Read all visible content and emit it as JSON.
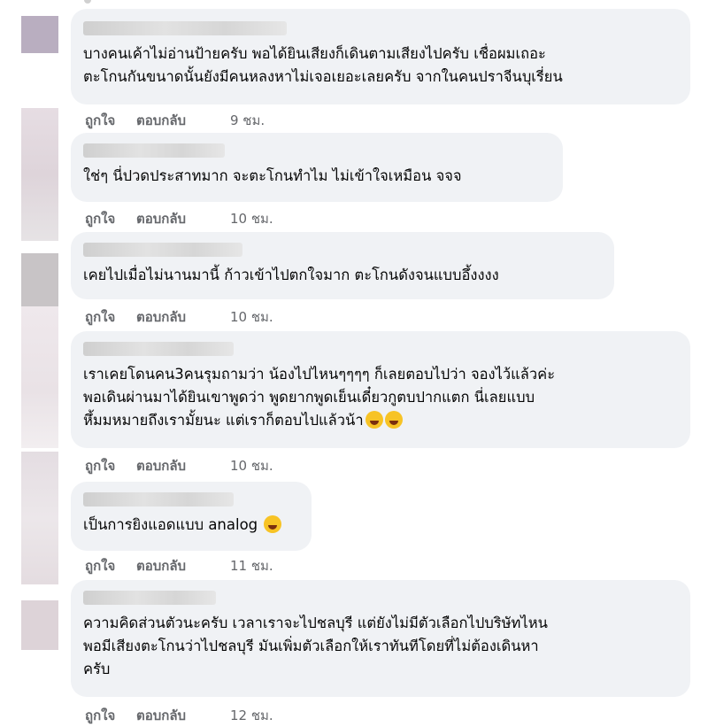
{
  "comments": [
    {
      "text": "บางคนเค้าไม่อ่านป้ายครับ พอได้ยินเสียงก็เดินตามเสียงไปครับ เชื่อผมเถอะ\nตะโกนกันขนาดนั้นยังมีคนหลงหาไม่เจอเยอะเลยครับ จากในคนปราจีนบุเรี่ยน",
      "like": "ถูกใจ",
      "reply": "ตอบกลับ",
      "time": "9 ชม.",
      "emoji": [],
      "avatar_color": "#b9aec0"
    },
    {
      "text": "ใช่ๆ นี่ปวดประสาทมาก จะตะโกนทำไม ไม่เข้าใจเหมือน จจจ",
      "like": "ถูกใจ",
      "reply": "ตอบกลับ",
      "time": "10 ชม.",
      "emoji": [],
      "avatar_color": "#e6dde3"
    },
    {
      "text": "เคยไปเมื่อไม่นานมานี้ ก้าวเข้าไปตกใจมาก ตะโกนดังจนแบบอึ้งงงง",
      "like": "ถูกใจ",
      "reply": "ตอบกลับ",
      "time": "10 ชม.",
      "emoji": [],
      "avatar_color": "#c8c4c6"
    },
    {
      "text": "เราเคยโดนคน3คนรุมถามว่า น้องไปไหนๆๆๆๆ ก็เลยตอบไปว่า จองไว้แล้วค่ะ\nพอเดินผ่านมาได้ยินเขาพูดว่า พูดยากพูดเย็นเดี๋ยวกูตบปากแตก นี่เลยแบบ\nหึ้มมหมายถึงเรามั้ยนะ แต่เราก็ตอบไปแล้วน้า",
      "like": "ถูกใจ",
      "reply": "ตอบกลับ",
      "time": "10 ชม.",
      "emoji": [
        "laughing-tears-emoji",
        "grinning-emoji"
      ],
      "avatar_color": "#efe8ec"
    },
    {
      "text": "เป็นการยิงแอดแบบ analog",
      "like": "ถูกใจ",
      "reply": "ตอบกลับ",
      "time": "11 ชม.",
      "emoji": [
        "tongue-out-emoji"
      ],
      "avatar_color": "#e4dde2"
    },
    {
      "text": "ความคิดส่วนตัวนะครับ เวลาเราจะไปชลบุรี แต่ยังไม่มีตัวเลือกไปบริษัทไหน\nพอมีเสียงตะโกนว่าไปชลบุรี มันเพิ่มตัวเลือกให้เราทันทีโดยที่ไม่ต้องเดินหา\nครับ",
      "like": "ถูกใจ",
      "reply": "ตอบกลับ",
      "time": "12 ชม.",
      "emoji": [],
      "avatar_color": "#ddd3d8"
    }
  ]
}
